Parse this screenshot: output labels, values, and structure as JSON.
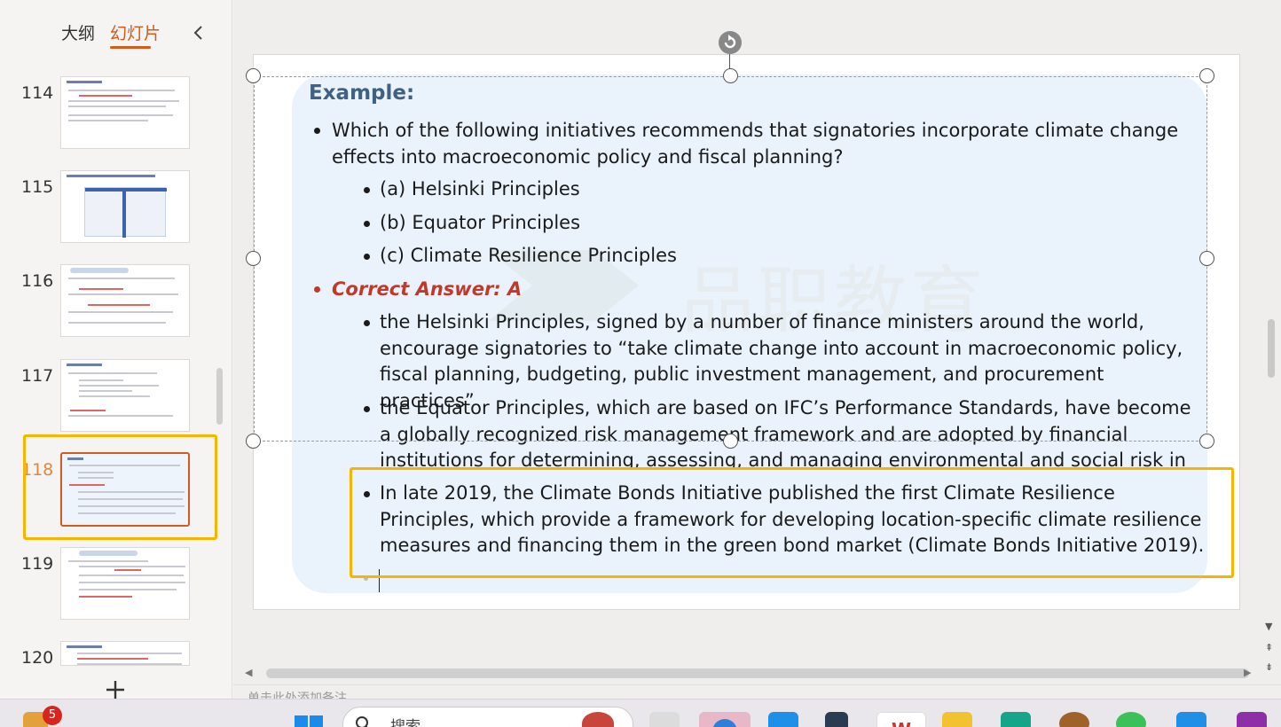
{
  "left_panel": {
    "tab_outline": "大纲",
    "tab_slides": "幻灯片",
    "slides": [
      {
        "number": "114"
      },
      {
        "number": "115"
      },
      {
        "number": "116"
      },
      {
        "number": "117"
      },
      {
        "number": "118",
        "active": true
      },
      {
        "number": "119"
      },
      {
        "number": "120"
      }
    ]
  },
  "slide": {
    "heading": "Example:",
    "question": "Which of the following initiatives recommends that signatories incorporate climate change effects into macroeconomic policy and fiscal planning?",
    "options": [
      "(a) Helsinki Principles",
      "(b) Equator Principles",
      "(c) Climate Resilience Principles"
    ],
    "answer": "Correct Answer: A",
    "explanations": [
      "the Helsinki Principles, signed by a number of finance ministers around the world, encourage signatories to “take climate change into account in macroeconomic policy, fiscal planning, budgeting, public investment management, and procurement practices”",
      "the Equator Principles, which are based on IFC’s Performance Standards, have become a globally recognized risk management framework and are adopted by financial institutions for determining, assessing, and managing environmental and social risk in project finance.",
      "In late 2019, the Climate Bonds Initiative published the first Climate Resilience Principles, which provide a framework for developing location-specific climate resilience measures and financing them in the green bond market (Climate Bonds Initiative 2019)."
    ],
    "watermark": "品职教育"
  },
  "notes": {
    "placeholder": "单击此处添加备注"
  },
  "taskbar": {
    "search_label": "搜索",
    "notification_count": "5"
  },
  "colors": {
    "accent": "#d35a1d",
    "highlight": "#f7b500",
    "heading": "#3e6184",
    "answer": "#c0392b"
  }
}
